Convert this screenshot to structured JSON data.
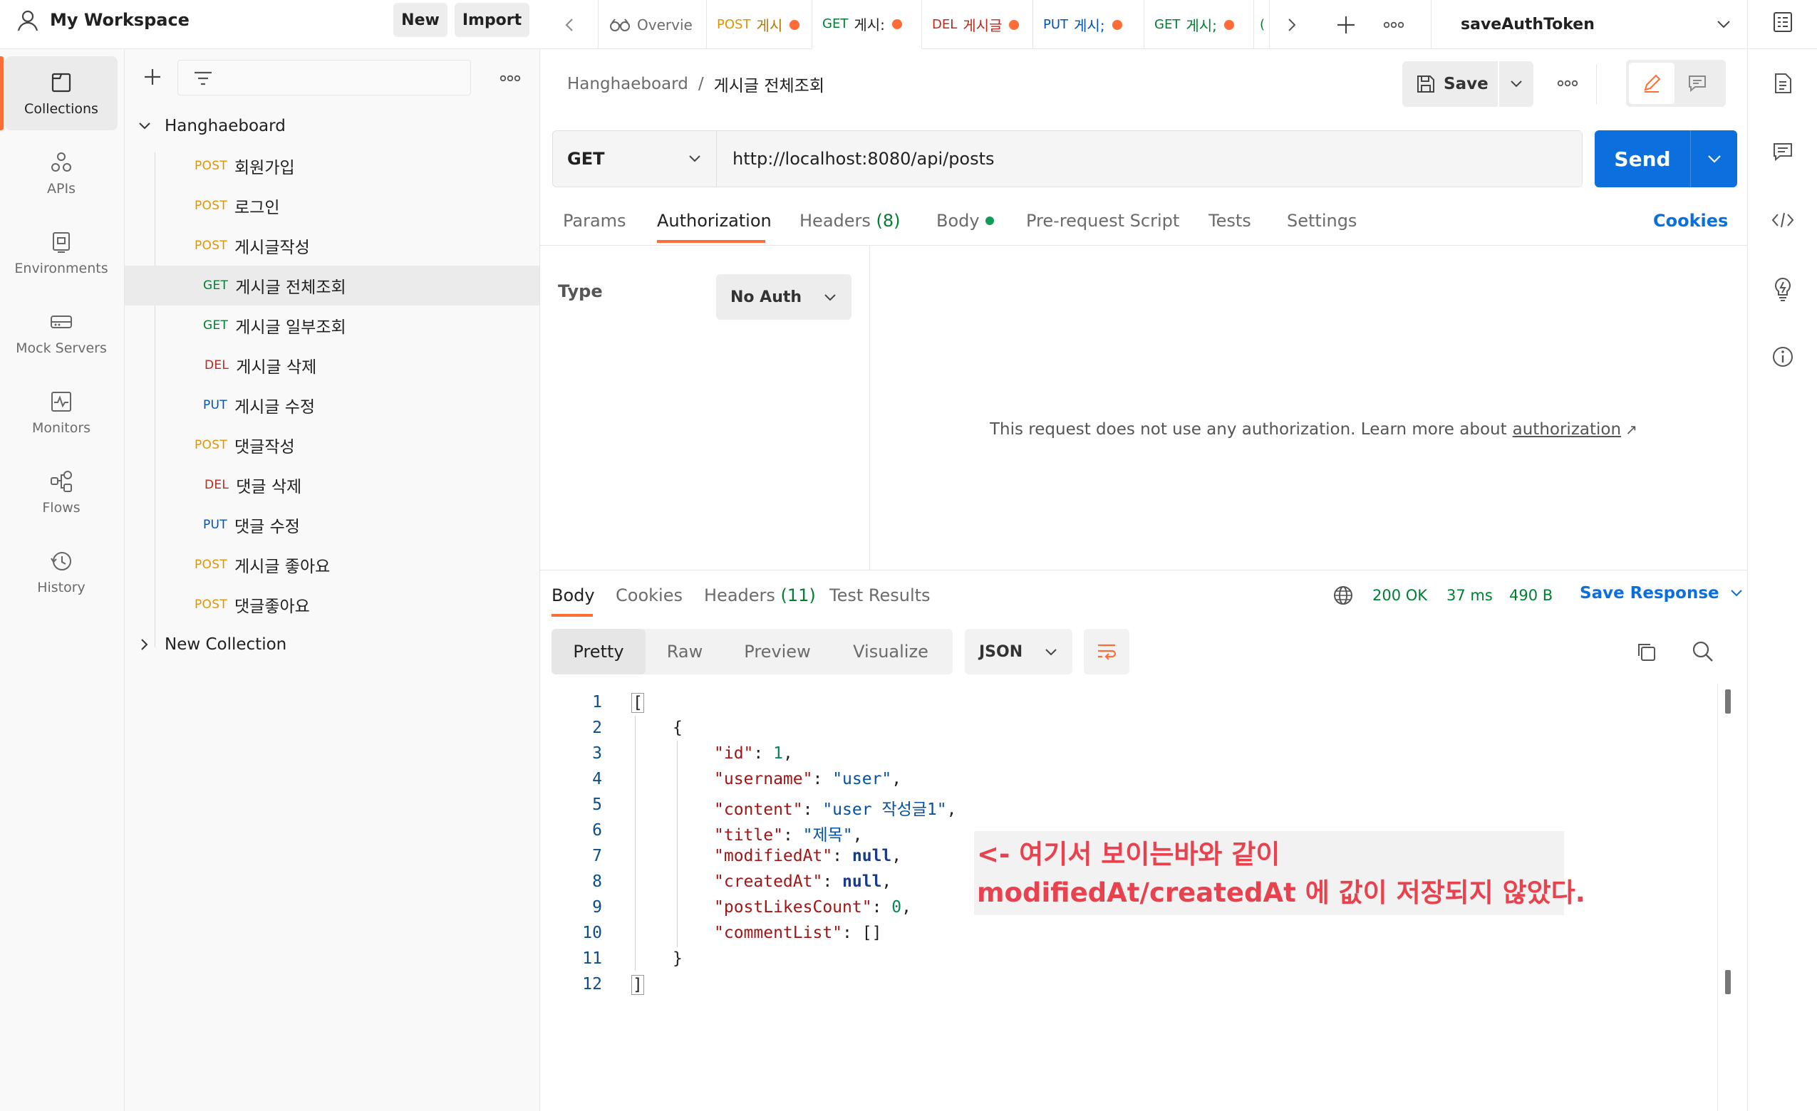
{
  "workspace": {
    "title": "My Workspace",
    "new_label": "New",
    "import_label": "Import"
  },
  "rail": [
    {
      "label": "Collections",
      "icon": "collections-icon",
      "active": true
    },
    {
      "label": "APIs",
      "icon": "apis-icon"
    },
    {
      "label": "Environments",
      "icon": "environments-icon"
    },
    {
      "label": "Mock Servers",
      "icon": "mock-servers-icon"
    },
    {
      "label": "Monitors",
      "icon": "monitors-icon"
    },
    {
      "label": "Flows",
      "icon": "flows-icon"
    },
    {
      "label": "History",
      "icon": "history-icon"
    }
  ],
  "sidebar": {
    "collection": "Hanghaeboard",
    "items": [
      {
        "method": "POST",
        "name": "회원가입"
      },
      {
        "method": "POST",
        "name": "로그인"
      },
      {
        "method": "POST",
        "name": "게시글작성"
      },
      {
        "method": "GET",
        "name": "게시글 전체조회"
      },
      {
        "method": "GET",
        "name": "게시글 일부조회"
      },
      {
        "method": "DEL",
        "name": "게시글 삭제"
      },
      {
        "method": "PUT",
        "name": "게시글 수정"
      },
      {
        "method": "POST",
        "name": "댓글작성"
      },
      {
        "method": "DEL",
        "name": "댓글 삭제"
      },
      {
        "method": "PUT",
        "name": "댓글 수정"
      },
      {
        "method": "POST",
        "name": "게시글 좋아요"
      },
      {
        "method": "POST",
        "name": "댓글좋아요"
      }
    ],
    "other_collection": "New Collection"
  },
  "tabs": [
    {
      "label": "Overvie"
    },
    {
      "method": "POST",
      "label": "게시"
    },
    {
      "method": "GET",
      "label": "게시:"
    },
    {
      "method": "DEL",
      "label": "게시글"
    },
    {
      "method": "PUT",
      "label": "게시;"
    },
    {
      "method": "GET",
      "label": "게시;"
    }
  ],
  "environment": "saveAuthToken",
  "request": {
    "breadcrumb_collection": "Hanghaeboard",
    "breadcrumb_sep": "/",
    "name": "게시글 전체조회",
    "save_label": "Save",
    "method": "GET",
    "url": "http://localhost:8080/api/posts",
    "send_label": "Send",
    "tabs": {
      "params": "Params",
      "authorization": "Authorization",
      "headers": "Headers",
      "headers_count": "(8)",
      "body": "Body",
      "pre_request": "Pre-request Script",
      "tests": "Tests",
      "settings": "Settings",
      "cookies": "Cookies"
    },
    "auth": {
      "type_label": "Type",
      "type_value": "No Auth",
      "message": "This request does not use any authorization. Learn more about",
      "link": "authorization",
      "link_arrow": "↗"
    }
  },
  "response": {
    "tabs": {
      "body": "Body",
      "cookies": "Cookies",
      "headers": "Headers",
      "headers_count": "(11)",
      "tests": "Test Results"
    },
    "status": "200 OK",
    "time": "37 ms",
    "size": "490 B",
    "save_response": "Save Response",
    "view_modes": [
      "Pretty",
      "Raw",
      "Preview",
      "Visualize"
    ],
    "format": "JSON",
    "line_numbers": [
      "1",
      "2",
      "3",
      "4",
      "5",
      "6",
      "7",
      "8",
      "9",
      "10",
      "11",
      "12"
    ],
    "json": {
      "open_bracket": "[",
      "open_brace": "{",
      "id_key": "\"id\"",
      "id_val": "1",
      "username_key": "\"username\"",
      "username_val": "\"user\"",
      "content_key": "\"content\"",
      "content_val": "\"user 작성글1\"",
      "title_key": "\"title\"",
      "title_val": "\"제목\"",
      "modified_key": "\"modifiedAt\"",
      "modified_val": "null",
      "created_key": "\"createdAt\"",
      "created_val": "null",
      "likes_key": "\"postLikesCount\"",
      "likes_val": "0",
      "comments_key": "\"commentList\"",
      "comments_val": "[]",
      "close_brace": "}",
      "close_bracket": "]"
    }
  },
  "annotation": {
    "line1": "<- 여기서 보이는바와 같이",
    "line2": "modifiedAt/createdAt 에 값이 저장되지 않았다."
  },
  "colors": {
    "accent": "#ff6c37",
    "send": "#0b6fde",
    "annotation_text": "#e8424f",
    "annotation_bg": "#f2f2f2",
    "status_green": "#007f31"
  }
}
